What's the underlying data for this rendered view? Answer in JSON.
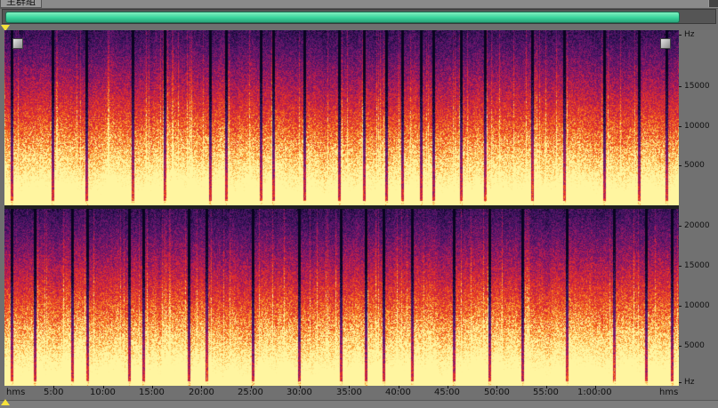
{
  "window": {
    "tab_title": "主群組"
  },
  "spectrogram": {
    "channels": [
      {
        "name": "top",
        "ticks": [
          {
            "label": "Hz",
            "hz": 21500
          },
          {
            "label": "15000",
            "hz": 15000
          },
          {
            "label": "10000",
            "hz": 10000
          },
          {
            "label": "5000",
            "hz": 5000
          }
        ]
      },
      {
        "name": "bottom",
        "ticks": [
          {
            "label": "20000",
            "hz": 20000
          },
          {
            "label": "15000",
            "hz": 15000
          },
          {
            "label": "10000",
            "hz": 10000
          },
          {
            "label": "5000",
            "hz": 5000
          },
          {
            "label": "Hz",
            "hz": 0
          }
        ]
      }
    ],
    "max_hz": 22050
  },
  "time_ruler": {
    "start_label": "hms",
    "end_label": "hms",
    "labels": [
      "5:00",
      "10:00",
      "15:00",
      "20:00",
      "25:00",
      "30:00",
      "35:00",
      "40:00",
      "45:00",
      "50:00",
      "55:00",
      "1:00:00"
    ],
    "total_minutes": 68.5
  },
  "colors": {
    "overview_bar": "#37d39a",
    "cursor_marker": "#f7e23a"
  }
}
